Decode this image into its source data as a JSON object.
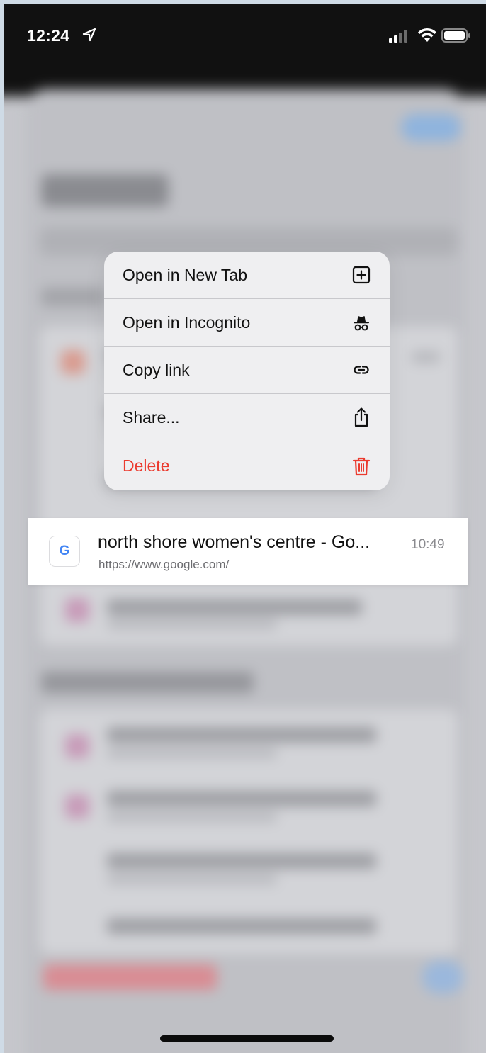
{
  "status_bar": {
    "time": "12:24",
    "icons": [
      "location-arrow-icon",
      "cellular-signal-icon",
      "wifi-icon",
      "battery-icon"
    ]
  },
  "context_menu": {
    "items": [
      {
        "label": "Open in New Tab",
        "icon": "plus-square-icon",
        "destructive": false
      },
      {
        "label": "Open in Incognito",
        "icon": "incognito-icon",
        "destructive": false
      },
      {
        "label": "Copy link",
        "icon": "link-icon",
        "destructive": false
      },
      {
        "label": "Share...",
        "icon": "share-icon",
        "destructive": false
      },
      {
        "label": "Delete",
        "icon": "trash-icon",
        "destructive": true
      }
    ]
  },
  "history_entry": {
    "favicon": "G",
    "title": "north shore women's centre - Go...",
    "url": "https://www.google.com/",
    "time": "10:49"
  },
  "colors": {
    "destructive": "#eb3b2f",
    "menu_background": "#efeff1",
    "backdrop": "#c6c7cc"
  }
}
